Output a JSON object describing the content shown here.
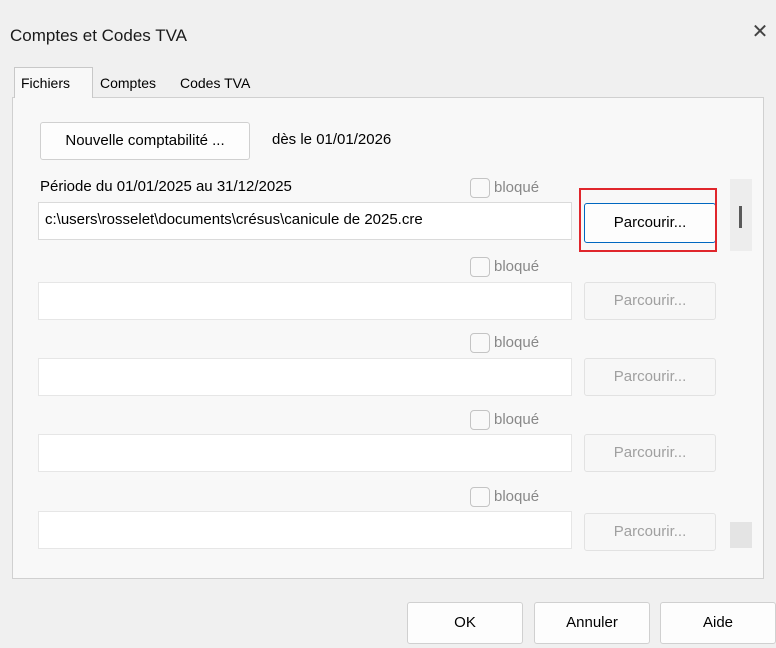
{
  "window": {
    "title": "Comptes et Codes TVA",
    "close_glyph": "✕"
  },
  "tabs": [
    {
      "label": "Fichiers",
      "active": true
    },
    {
      "label": "Comptes",
      "active": false
    },
    {
      "label": "Codes TVA",
      "active": false
    }
  ],
  "new_accounting": {
    "button_label": "Nouvelle comptabilité ...",
    "date_text": "dès le 01/01/2026"
  },
  "periods": [
    {
      "label": "Période du 01/01/2025 au 31/12/2025",
      "locked_label": "bloqué",
      "locked": false,
      "path": "c:\\users\\rosselet\\documents\\crésus\\canicule de 2025.cre",
      "browse_label": "Parcourir...",
      "browse_enabled": true
    },
    {
      "label": "",
      "locked_label": "bloqué",
      "locked": false,
      "path": "",
      "browse_label": "Parcourir...",
      "browse_enabled": false
    },
    {
      "label": "",
      "locked_label": "bloqué",
      "locked": false,
      "path": "",
      "browse_label": "Parcourir...",
      "browse_enabled": false
    },
    {
      "label": "",
      "locked_label": "bloqué",
      "locked": false,
      "path": "",
      "browse_label": "Parcourir...",
      "browse_enabled": false
    },
    {
      "label": "",
      "locked_label": "bloqué",
      "locked": false,
      "path": "",
      "browse_label": "Parcourir...",
      "browse_enabled": false
    }
  ],
  "footer": {
    "ok_label": "OK",
    "cancel_label": "Annuler",
    "help_label": "Aide"
  },
  "colors": {
    "highlight": "#e0262c",
    "focus_border": "#0067c0"
  }
}
